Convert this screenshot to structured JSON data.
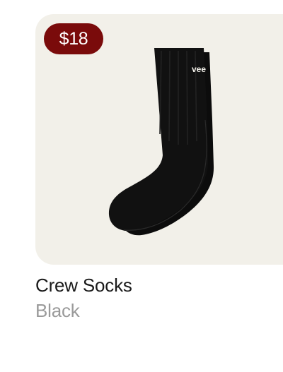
{
  "product": {
    "price": "$18",
    "name": "Crew Socks",
    "variant": "Black",
    "image_label": "vee",
    "icon": "sock-image",
    "colors": {
      "card_background": "#f2f0e9",
      "badge_background": "#7a0b0b",
      "badge_text": "#ffffff",
      "name_text": "#1a1a1a",
      "variant_text": "#9a9a9a",
      "sock": "#0c0c0c"
    }
  }
}
